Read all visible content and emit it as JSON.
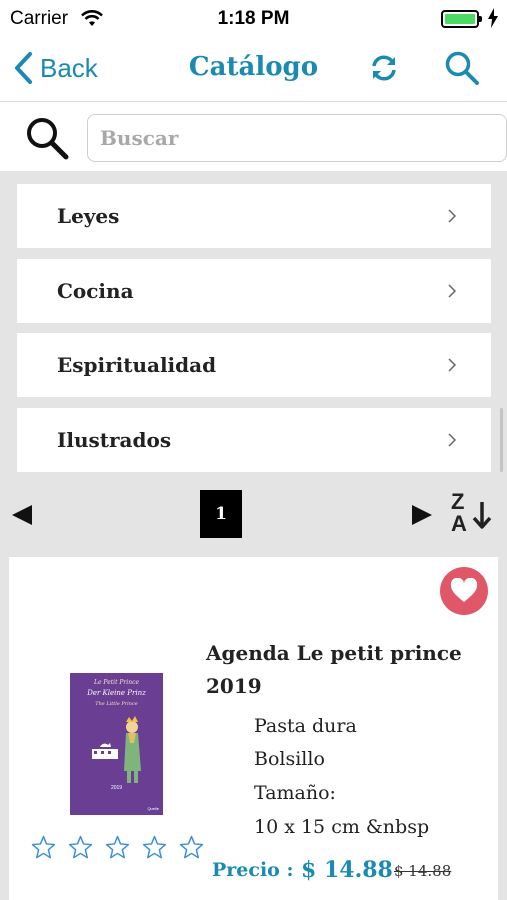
{
  "status_bar": {
    "carrier": "Carrier",
    "time": "1:18 PM",
    "battery_level": 1.0
  },
  "nav": {
    "back_label": "Back",
    "title": "Catálogo",
    "icons": [
      "chevron-left-icon",
      "refresh-icon",
      "search-icon"
    ],
    "accent_color": "#1a8ab3"
  },
  "search": {
    "placeholder": "Buscar",
    "value": ""
  },
  "categories": [
    {
      "label": "Leyes"
    },
    {
      "label": "Cocina"
    },
    {
      "label": "Espiritualidad"
    },
    {
      "label": "Ilustrados"
    }
  ],
  "pagination": {
    "current_page": "1",
    "sort_letters": {
      "top": "Z",
      "bottom": "A"
    }
  },
  "product": {
    "title": "Agenda Le petit prince 2019",
    "details": [
      "Pasta dura",
      "Bolsillo",
      "Tamaño:",
      "10 x 15 cm &nbsp"
    ],
    "price_label": "Precio :",
    "price": "$ 14.88",
    "old_price": "$ 14.88",
    "rating": 0,
    "rating_max": 5,
    "favorite": true,
    "favorite_color": "#e05767",
    "cover": {
      "line1": "Le Petit Prince",
      "line2": "Der Kleine Prinz",
      "line3": "The Little Prince",
      "year": "2019",
      "publisher": "Quelle"
    }
  }
}
